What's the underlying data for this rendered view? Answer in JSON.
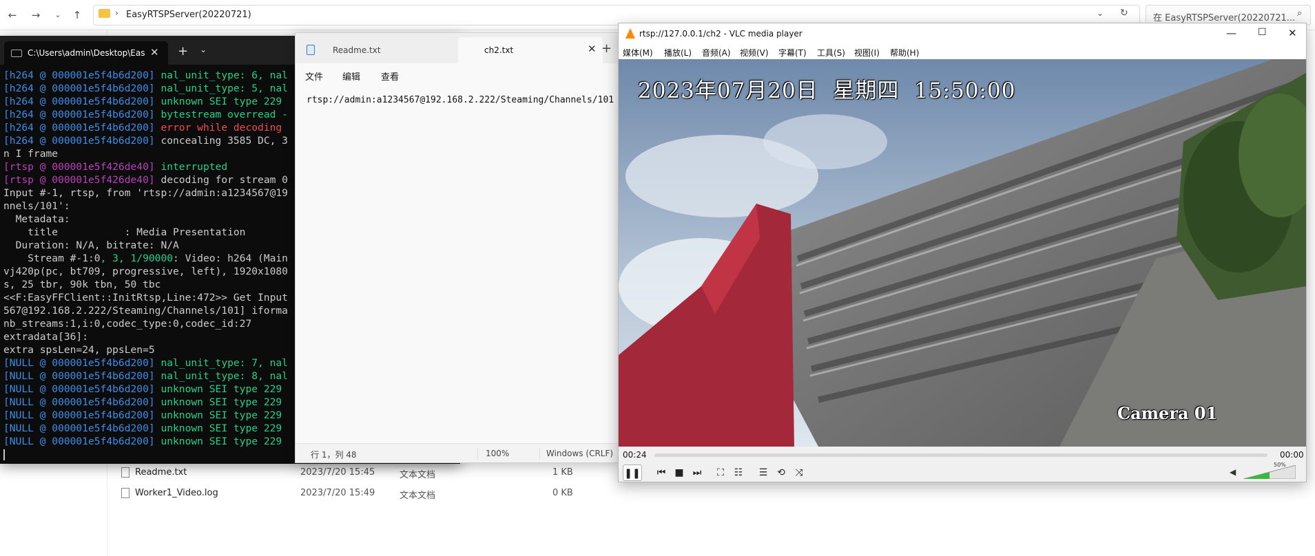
{
  "explorer": {
    "path": "EasyRTSPServer(20220721)",
    "search_placeholder": "在 EasyRTSPServer(20220721...",
    "files": [
      {
        "name": "Readme.txt",
        "date": "2023/7/20 15:45",
        "type": "文本文档",
        "size": "1 KB"
      },
      {
        "name": "Worker1_Video.log",
        "date": "2023/7/20 15:49",
        "type": "文本文档",
        "size": "0 KB"
      }
    ]
  },
  "terminal": {
    "tab_title": "C:\\Users\\admin\\Desktop\\Easy",
    "lines": [
      [
        [
          "[h264 @ 000001e5f4b6d200] ",
          "blue"
        ],
        [
          "nal_unit_type: 6, nal",
          "green"
        ]
      ],
      [
        [
          "[h264 @ 000001e5f4b6d200] ",
          "blue"
        ],
        [
          "nal_unit_type: 5, nal",
          "green"
        ]
      ],
      [
        [
          "[h264 @ 000001e5f4b6d200] ",
          "blue"
        ],
        [
          "unknown SEI type 229",
          "green"
        ]
      ],
      [
        [
          "[h264 @ 000001e5f4b6d200] ",
          "blue"
        ],
        [
          "bytestream overread -",
          "green"
        ]
      ],
      [
        [
          "[h264 @ 000001e5f4b6d200] ",
          "blue"
        ],
        [
          "error while decoding",
          "red"
        ]
      ],
      [
        [
          "[h264 @ 000001e5f4b6d200] ",
          "blue"
        ],
        [
          "concealing 3585 DC, 3",
          "white"
        ]
      ],
      [
        [
          "n I frame",
          "white"
        ]
      ],
      [
        [
          "[rtsp @ 000001e5f426de40] ",
          "purple"
        ],
        [
          "interrupted",
          "green"
        ]
      ],
      [
        [
          "[rtsp @ 000001e5f426de40] ",
          "purple"
        ],
        [
          "decoding for stream 0",
          "white"
        ]
      ],
      [
        [
          "Input #-1, rtsp, from 'rtsp://admin:a1234567@19",
          "white"
        ]
      ],
      [
        [
          "nnels/101':",
          "white"
        ]
      ],
      [
        [
          "  Metadata:",
          "white"
        ]
      ],
      [
        [
          "    title           : Media Presentation",
          "white"
        ]
      ],
      [
        [
          "  Duration: N/A, bitrate: N/A",
          "white"
        ]
      ],
      [
        [
          "    Stream #-1:0",
          "white"
        ],
        [
          ", 3, 1/90000",
          "green"
        ],
        [
          ": Video: h264 (Main",
          "white"
        ]
      ],
      [
        [
          "vj420p(pc, bt709, progressive, left), 1920x1080",
          "white"
        ]
      ],
      [
        [
          "s, 25 tbr, 90k tbn, 50 tbc",
          "white"
        ]
      ],
      [
        [
          "<<F:EasyFFClient::InitRtsp,Line:472>> Get Input",
          "white"
        ]
      ],
      [
        [
          "567@192.168.2.222/Steaming/Channels/101] iforma",
          "white"
        ]
      ],
      [
        [
          "nb_streams:1,i:0,codec_type:0,codec_id:27",
          "white"
        ]
      ],
      [
        [
          "extradata[36]:",
          "white"
        ]
      ],
      [
        [
          "extra spsLen=24, ppsLen=5",
          "white"
        ]
      ],
      [
        [
          "[NULL @ 000001e5f4b6d200] ",
          "blue"
        ],
        [
          "nal_unit_type: 7, nal",
          "green"
        ]
      ],
      [
        [
          "[NULL @ 000001e5f4b6d200] ",
          "blue"
        ],
        [
          "nal_unit_type: 8, nal",
          "green"
        ]
      ],
      [
        [
          "[NULL @ 000001e5f4b6d200] ",
          "blue"
        ],
        [
          "unknown SEI type 229",
          "green"
        ]
      ],
      [
        [
          "[NULL @ 000001e5f4b6d200] ",
          "blue"
        ],
        [
          "unknown SEI type 229",
          "green"
        ]
      ],
      [
        [
          "[NULL @ 000001e5f4b6d200] ",
          "blue"
        ],
        [
          "unknown SEI type 229",
          "green"
        ]
      ],
      [
        [
          "[NULL @ 000001e5f4b6d200] ",
          "blue"
        ],
        [
          "unknown SEI type 229",
          "green"
        ]
      ],
      [
        [
          "[NULL @ 000001e5f4b6d200] ",
          "blue"
        ],
        [
          "unknown SEI type 229",
          "green"
        ]
      ]
    ]
  },
  "notepad": {
    "tab1": "Readme.txt",
    "tab2": "ch2.txt",
    "menu": [
      "文件",
      "编辑",
      "查看"
    ],
    "content": "rtsp://admin:a1234567@192.168.2.222/Steaming/Channels/101",
    "status": {
      "position": "行 1，列 48",
      "zoom": "100%",
      "eol": "Windows (CRLF)"
    }
  },
  "vlc": {
    "title": "rtsp://127.0.0.1/ch2 - VLC media player",
    "menu": [
      "媒体(M)",
      "播放(L)",
      "音频(A)",
      "视频(V)",
      "字幕(T)",
      "工具(S)",
      "视图(I)",
      "帮助(H)"
    ],
    "osd_time": "2023年07月20日  星期四  15:50:00",
    "osd_camera": "Camera 01",
    "elapsed": "00:24",
    "remaining": "00:00",
    "progress": 0,
    "volume_label": "50%",
    "volume": 0.5
  }
}
